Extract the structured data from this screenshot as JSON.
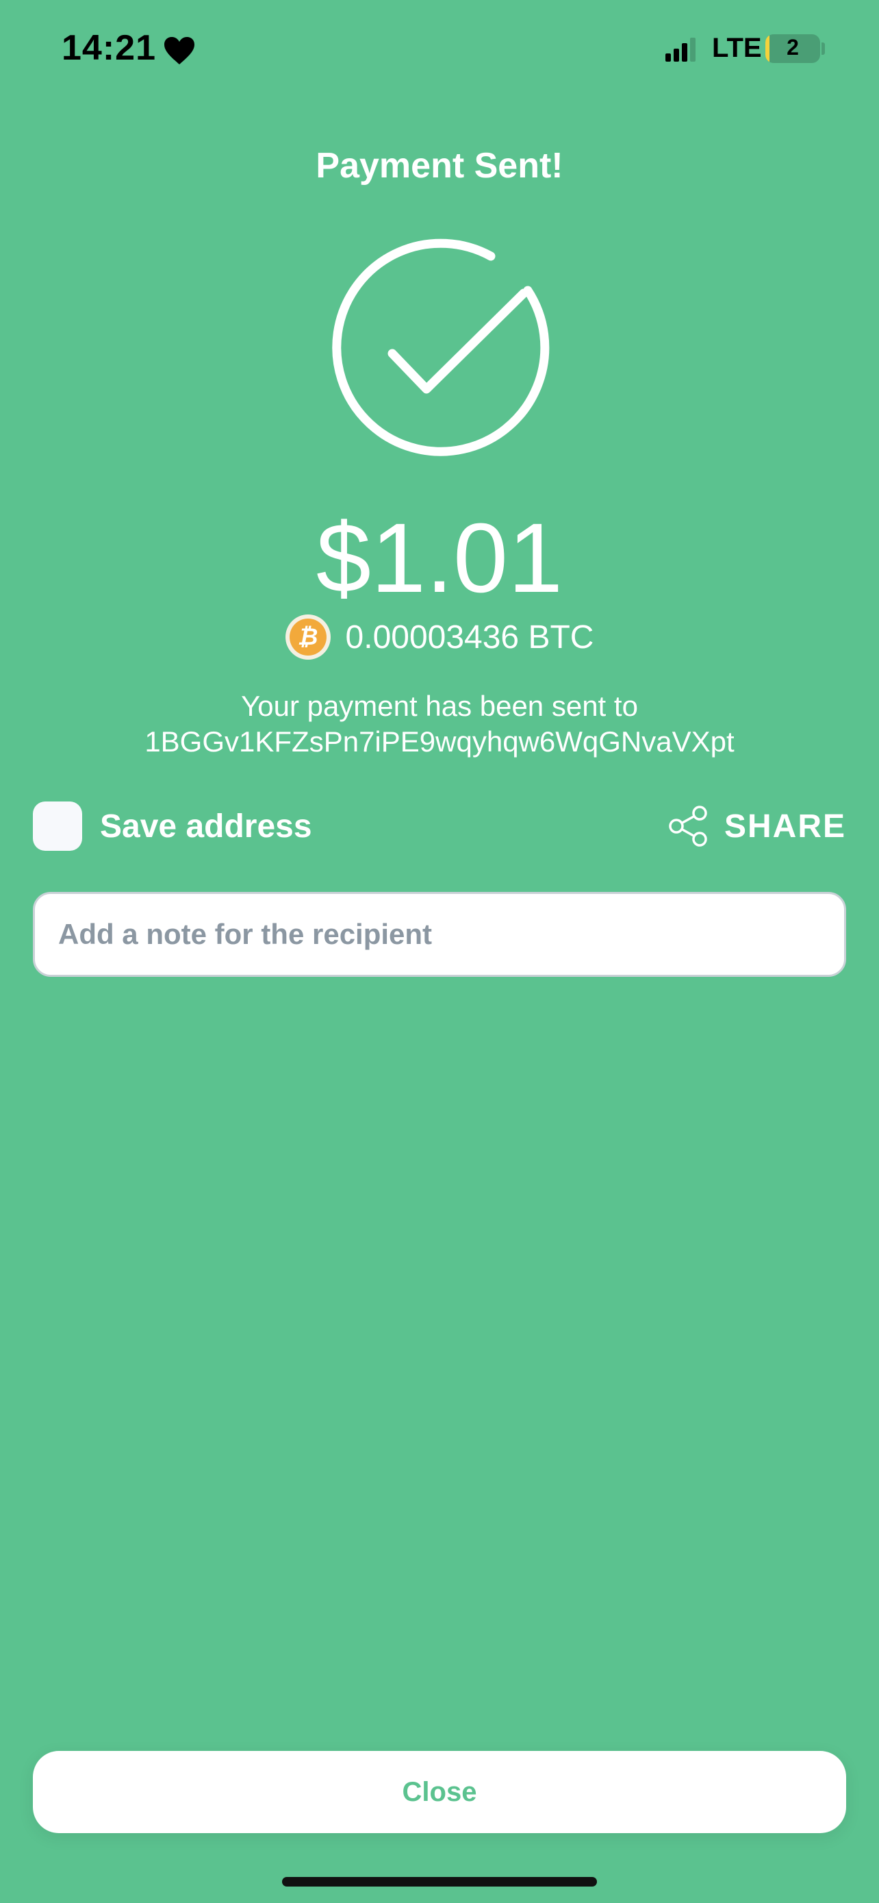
{
  "status_bar": {
    "time": "14:21",
    "network": "LTE",
    "battery": "2",
    "icons": [
      "heart-icon",
      "signal-icon",
      "battery-icon"
    ]
  },
  "header": {
    "title": "Payment Sent!"
  },
  "payment": {
    "amount_usd": "$1.01",
    "amount_btc": "0.00003436 BTC",
    "message_line1": "Your payment has been sent to",
    "address": "1BGGv1KFZsPn7iPE9wqyhqw6WqGNvaVXpt"
  },
  "options": {
    "save_address_label": "Save address",
    "share_label": "SHARE"
  },
  "note": {
    "placeholder": "Add a note for the recipient",
    "value": ""
  },
  "footer": {
    "close_label": "Close"
  },
  "colors": {
    "background": "#5BC28F",
    "accent": "#5BC28F",
    "bitcoin": "#F2A93B",
    "white": "#FFFFFF"
  }
}
